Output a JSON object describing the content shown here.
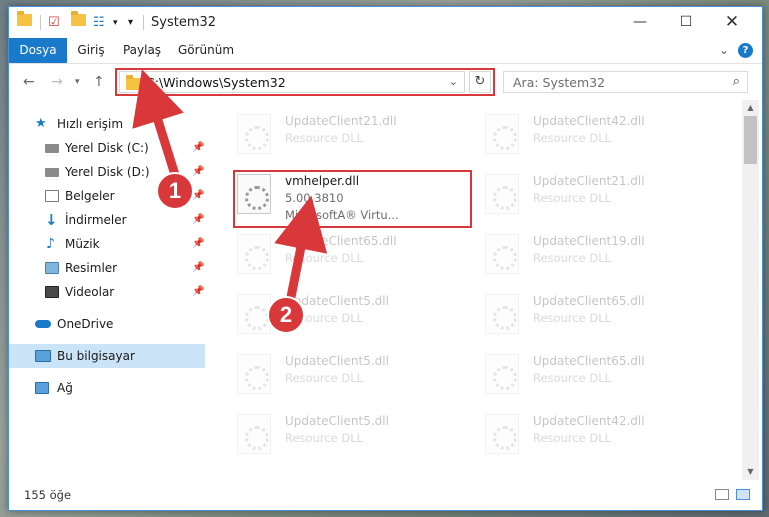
{
  "window": {
    "title": "System32"
  },
  "ribbon": {
    "tabs": [
      "Dosya",
      "Giriş",
      "Paylaş",
      "Görünüm"
    ]
  },
  "address": {
    "path": "C:\\Windows\\System32",
    "search_placeholder": "Ara: System32"
  },
  "sidebar": {
    "items": [
      {
        "label": "Hızlı erişim",
        "icon": "star-icon"
      },
      {
        "label": "Yerel Disk (C:)",
        "icon": "drive-icon",
        "pinned": true
      },
      {
        "label": "Yerel Disk (D:)",
        "icon": "drive-icon",
        "pinned": true
      },
      {
        "label": "Belgeler",
        "icon": "documents-icon",
        "pinned": true
      },
      {
        "label": "İndirmeler",
        "icon": "download-icon",
        "pinned": true
      },
      {
        "label": "Müzik",
        "icon": "music-icon",
        "pinned": true
      },
      {
        "label": "Resimler",
        "icon": "pictures-icon",
        "pinned": true
      },
      {
        "label": "Videolar",
        "icon": "videos-icon",
        "pinned": true
      },
      {
        "label": "OneDrive",
        "icon": "cloud-icon"
      },
      {
        "label": "Bu bilgisayar",
        "icon": "computer-icon",
        "selected": true
      },
      {
        "label": "Ağ",
        "icon": "network-icon"
      }
    ]
  },
  "files": {
    "left": [
      {
        "name": "UpdateClient21.dll",
        "sub": "Resource DLL"
      },
      {
        "name": "vmhelper.dll",
        "sub": "5.00.3810",
        "sub2": "MicrosoftA® Virtu..."
      },
      {
        "name": "UpdateClient65.dll",
        "sub": "Resource DLL"
      },
      {
        "name": "UpdateClient5.dll",
        "sub": "Resource DLL"
      },
      {
        "name": "UpdateClient5.dll",
        "sub": "Resource DLL"
      },
      {
        "name": "UpdateClient5.dll",
        "sub": "Resource DLL"
      }
    ],
    "right": [
      {
        "name": "UpdateClient42.dll",
        "sub": "Resource DLL"
      },
      {
        "name": "UpdateClient21.dll",
        "sub": "Resource DLL"
      },
      {
        "name": "UpdateClient19.dll",
        "sub": "Resource DLL"
      },
      {
        "name": "UpdateClient65.dll",
        "sub": "Resource DLL"
      },
      {
        "name": "UpdateClient65.dll",
        "sub": "Resource DLL"
      },
      {
        "name": "UpdateClient42.dll",
        "sub": "Resource DLL"
      }
    ]
  },
  "status": {
    "count": "155 öğe"
  },
  "annotations": {
    "step1": "1",
    "step2": "2"
  },
  "colors": {
    "accent": "#1979ca",
    "annotation": "#d9383a",
    "selected": "#cce4f7"
  }
}
